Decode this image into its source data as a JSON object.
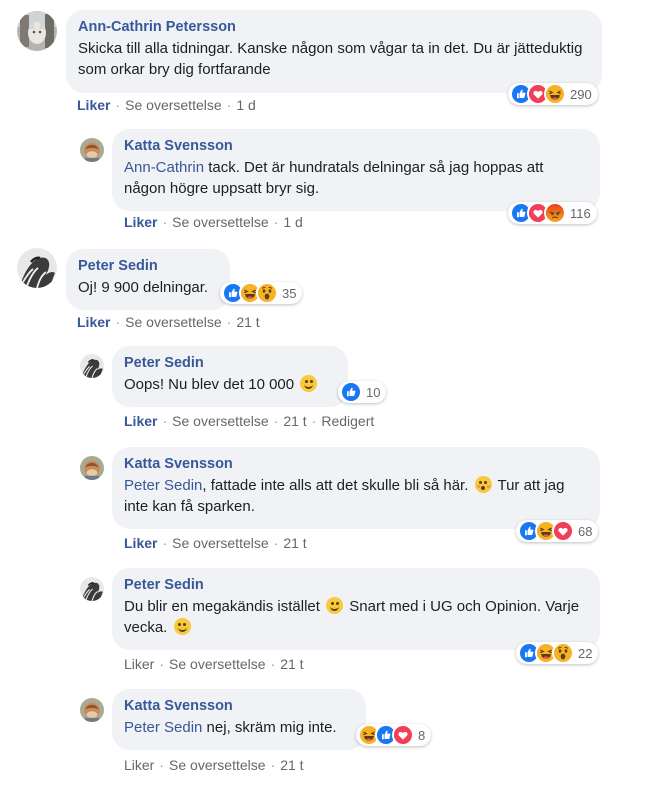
{
  "comments": [
    {
      "author": "Ann-Cathrin Petersson",
      "text": "Skicka till alla tidningar. Kanske någon som vågar ta in det. Du är jätteduktig som orkar bry dig fortfarande",
      "reaction_count": "290",
      "actions": {
        "like": "Liker",
        "translate": "Se oversettelse",
        "time": "1 d"
      }
    },
    {
      "author": "Katta Svensson",
      "mention": "Ann-Cathrin",
      "text": " tack. Det är hundratals delningar så jag hoppas att någon högre uppsatt bryr sig.",
      "reaction_count": "116",
      "actions": {
        "like": "Liker",
        "translate": "Se oversettelse",
        "time": "1 d"
      }
    },
    {
      "author": "Peter Sedin",
      "text": "Oj! 9 900 delningar.",
      "reaction_count": "35",
      "actions": {
        "like": "Liker",
        "translate": "Se oversettelse",
        "time": "21 t"
      }
    },
    {
      "author": "Peter Sedin",
      "text": "Oops! Nu blev det 10 000",
      "reaction_count": "10",
      "actions": {
        "like": "Liker",
        "translate": "Se oversettelse",
        "time": "21 t",
        "edited": "Redigert"
      }
    },
    {
      "author": "Katta Svensson",
      "mention": "Peter Sedin",
      "text": ", fattade inte alls att det skulle bli så här.",
      "text2": " Tur att jag inte kan få sparken.",
      "reaction_count": "68",
      "actions": {
        "like": "Liker",
        "translate": "Se oversettelse",
        "time": "21 t"
      }
    },
    {
      "author": "Peter Sedin",
      "text": "Du blir en megakändis istället",
      "text2": " Snart med i UG och Opinion. Varje vecka.",
      "reaction_count": "22",
      "actions": {
        "like": "Liker",
        "translate": "Se oversettelse",
        "time": "21 t"
      }
    },
    {
      "author": "Katta Svensson",
      "mention": "Peter Sedin",
      "text": " nej, skräm mig inte.",
      "reaction_count": "8",
      "actions": {
        "like": "Liker",
        "translate": "Se oversettelse",
        "time": "21 t"
      }
    }
  ],
  "colors": {
    "like": "#1877f2",
    "love": "#f33e58",
    "haha": "#f7b125",
    "angry": "#e9710f",
    "link": "#385898",
    "bubble": "#f0f2f5"
  },
  "icons": [
    "like-icon",
    "love-icon",
    "haha-icon",
    "wow-icon",
    "angry-icon",
    "smile-emoji",
    "flushed-emoji"
  ]
}
